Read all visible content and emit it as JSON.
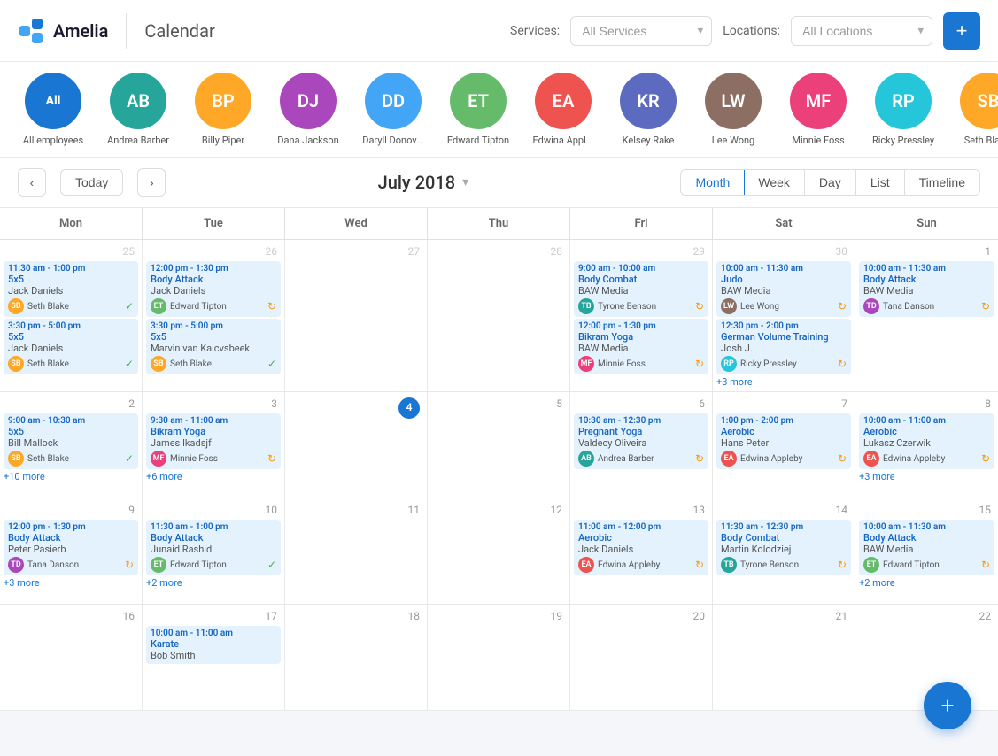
{
  "app": {
    "name": "Amelia",
    "page": "Calendar"
  },
  "header": {
    "services_label": "Services:",
    "services_placeholder": "All Services",
    "locations_label": "Locations:",
    "locations_placeholder": "All Locations",
    "add_button": "+"
  },
  "employees": [
    {
      "id": "all",
      "label": "All employees",
      "initials": "All",
      "color": "blue",
      "selected": true
    },
    {
      "id": "andrea",
      "label": "Andrea Barber",
      "initials": "AB",
      "color": "av-teal"
    },
    {
      "id": "billy",
      "label": "Billy Piper",
      "initials": "BP",
      "color": "av-orange"
    },
    {
      "id": "dana",
      "label": "Dana Jackson",
      "initials": "DJ",
      "color": "av-purple"
    },
    {
      "id": "daryll",
      "label": "Daryll Donov...",
      "initials": "DD",
      "color": "av-blue"
    },
    {
      "id": "edward",
      "label": "Edward Tipton",
      "initials": "ET",
      "color": "av-green"
    },
    {
      "id": "edwina",
      "label": "Edwina Appl...",
      "initials": "EA",
      "color": "av-red"
    },
    {
      "id": "kelsey",
      "label": "Kelsey Rake",
      "initials": "KR",
      "color": "av-indigo"
    },
    {
      "id": "lee",
      "label": "Lee Wong",
      "initials": "LW",
      "color": "av-brown"
    },
    {
      "id": "minnie",
      "label": "Minnie Foss",
      "initials": "MF",
      "color": "av-pink"
    },
    {
      "id": "ricky",
      "label": "Ricky Pressley",
      "initials": "RP",
      "color": "av-cyan"
    },
    {
      "id": "seth",
      "label": "Seth Blak...",
      "initials": "SB",
      "color": "av-orange"
    }
  ],
  "toolbar": {
    "prev_label": "‹",
    "next_label": "›",
    "today_label": "Today",
    "month_label": "July 2018",
    "view_month": "Month",
    "view_week": "Week",
    "view_day": "Day",
    "view_list": "List",
    "view_timeline": "Timeline"
  },
  "calendar": {
    "headers": [
      "Mon",
      "Tue",
      "Wed",
      "Thu",
      "Fri",
      "Sat",
      "Sun"
    ],
    "weeks": [
      {
        "days": [
          {
            "date": "25",
            "prev_month": true,
            "events": [
              {
                "time": "11:30 am - 1:00 pm",
                "title": "5x5",
                "subtitle": "Jack Daniels",
                "attendee": "Seth Blake",
                "initials": "SB",
                "color": "av-orange",
                "status": "green"
              },
              {
                "time": "3:30 pm - 5:00 pm",
                "title": "5x5",
                "subtitle": "Jack Daniels",
                "attendee": "Seth Blake",
                "initials": "SB",
                "color": "av-orange",
                "status": "green"
              }
            ]
          },
          {
            "date": "26",
            "prev_month": true,
            "events": [
              {
                "time": "12:00 pm - 1:30 pm",
                "title": "Body Attack",
                "subtitle": "Jack Daniels",
                "attendee": "Edward Tipton",
                "initials": "ET",
                "color": "av-green",
                "status": "orange"
              },
              {
                "time": "3:30 pm - 5:00 pm",
                "title": "5x5",
                "subtitle": "Marvin van Kalcvsbeek",
                "attendee": "Seth Blake",
                "initials": "SB",
                "color": "av-orange",
                "status": "green"
              }
            ]
          },
          {
            "date": "27",
            "prev_month": true,
            "events": []
          },
          {
            "date": "28",
            "prev_month": true,
            "events": []
          },
          {
            "date": "29",
            "prev_month": true,
            "events": [
              {
                "time": "9:00 am - 10:00 am",
                "title": "Body Combat",
                "subtitle": "BAW Media",
                "attendee": "Tyrone Benson",
                "initials": "TB",
                "color": "av-teal",
                "status": "orange"
              },
              {
                "time": "12:00 pm - 1:30 pm",
                "title": "Bikram Yoga",
                "subtitle": "BAW Media",
                "attendee": "Minnie Foss",
                "initials": "MF",
                "color": "av-pink",
                "status": "orange"
              }
            ]
          },
          {
            "date": "30",
            "prev_month": true,
            "events": [
              {
                "time": "10:00 am - 11:30 am",
                "title": "Judo",
                "subtitle": "BAW Media",
                "attendee": "Lee Wong",
                "initials": "LW",
                "color": "av-brown",
                "status": "orange"
              },
              {
                "time": "12:30 pm - 2:00 pm",
                "title": "German Volume Training",
                "subtitle": "Josh J.",
                "attendee": "Ricky Pressley",
                "initials": "RP",
                "color": "av-cyan",
                "status": "orange"
              },
              {
                "more": "+3 more"
              }
            ]
          },
          {
            "date": "1",
            "events": [
              {
                "time": "10:00 am - 11:30 am",
                "title": "Body Attack",
                "subtitle": "BAW Media",
                "attendee": "Tana Danson",
                "initials": "TD",
                "color": "av-purple",
                "status": "orange"
              }
            ]
          }
        ]
      },
      {
        "days": [
          {
            "date": "2",
            "events": [
              {
                "time": "9:00 am - 10:30 am",
                "title": "5x5",
                "subtitle": "Bill Mallock",
                "attendee": "Seth Blake",
                "initials": "SB",
                "color": "av-orange",
                "status": "green"
              },
              {
                "more": "+10 more"
              }
            ]
          },
          {
            "date": "3",
            "events": [
              {
                "time": "9:30 am - 11:00 am",
                "title": "Bikram Yoga",
                "subtitle": "James Ikadsjf",
                "attendee": "Minnie Foss",
                "initials": "MF",
                "color": "av-pink",
                "status": "orange"
              },
              {
                "more": "+6 more"
              }
            ]
          },
          {
            "date": "4",
            "today": true,
            "events": []
          },
          {
            "date": "5",
            "events": []
          },
          {
            "date": "6",
            "events": [
              {
                "time": "10:30 am - 12:30 pm",
                "title": "Pregnant Yoga",
                "subtitle": "Valdecy Oliveira",
                "attendee": "Andrea Barber",
                "initials": "AB",
                "color": "av-teal",
                "status": "orange"
              }
            ]
          },
          {
            "date": "7",
            "events": [
              {
                "time": "1:00 pm - 2:00 pm",
                "title": "Aerobic",
                "subtitle": "Hans Peter",
                "attendee": "Edwina Appleby",
                "initials": "EA",
                "color": "av-red",
                "status": "orange"
              }
            ]
          },
          {
            "date": "8",
            "events": [
              {
                "time": "10:00 am - 11:00 am",
                "title": "Aerobic",
                "subtitle": "Lukasz Czerwik",
                "attendee": "Edwina Appleby",
                "initials": "EA",
                "color": "av-red",
                "status": "orange"
              },
              {
                "more": "+3 more"
              }
            ]
          }
        ]
      },
      {
        "days": [
          {
            "date": "9",
            "events": [
              {
                "time": "12:00 pm - 1:30 pm",
                "title": "Body Attack",
                "subtitle": "Peter Pasierb",
                "attendee": "Tana Danson",
                "initials": "TD",
                "color": "av-purple",
                "status": "orange"
              },
              {
                "more": "+3 more"
              }
            ]
          },
          {
            "date": "10",
            "events": [
              {
                "time": "11:30 am - 1:00 pm",
                "title": "Body Attack",
                "subtitle": "Junaid Rashid",
                "attendee": "Edward Tipton",
                "initials": "ET",
                "color": "av-green",
                "status": "green"
              },
              {
                "more": "+2 more"
              }
            ]
          },
          {
            "date": "11",
            "events": []
          },
          {
            "date": "12",
            "events": []
          },
          {
            "date": "13",
            "events": [
              {
                "time": "11:00 am - 12:00 pm",
                "title": "Aerobic",
                "subtitle": "Jack Daniels",
                "attendee": "Edwina Appleby",
                "initials": "EA",
                "color": "av-red",
                "status": "orange"
              }
            ]
          },
          {
            "date": "14",
            "events": [
              {
                "time": "11:30 am - 12:30 pm",
                "title": "Body Combat",
                "subtitle": "Martin Kolodziej",
                "attendee": "Tyrone Benson",
                "initials": "TB",
                "color": "av-teal",
                "status": "orange"
              }
            ]
          },
          {
            "date": "15",
            "events": [
              {
                "time": "10:00 am - 11:30 am",
                "title": "Body Attack",
                "subtitle": "BAW Media",
                "attendee": "Edward Tipton",
                "initials": "ET",
                "color": "av-green",
                "status": "orange"
              },
              {
                "more": "+2 more"
              }
            ]
          }
        ]
      },
      {
        "days": [
          {
            "date": "16",
            "events": []
          },
          {
            "date": "17",
            "events": [
              {
                "time": "10:00 am - 11:00 am",
                "title": "Karate",
                "subtitle": "Bob Smith",
                "attendee": null
              }
            ]
          },
          {
            "date": "18",
            "events": []
          },
          {
            "date": "19",
            "events": []
          },
          {
            "date": "20",
            "events": []
          },
          {
            "date": "21",
            "events": []
          },
          {
            "date": "22",
            "events": []
          }
        ]
      }
    ]
  }
}
